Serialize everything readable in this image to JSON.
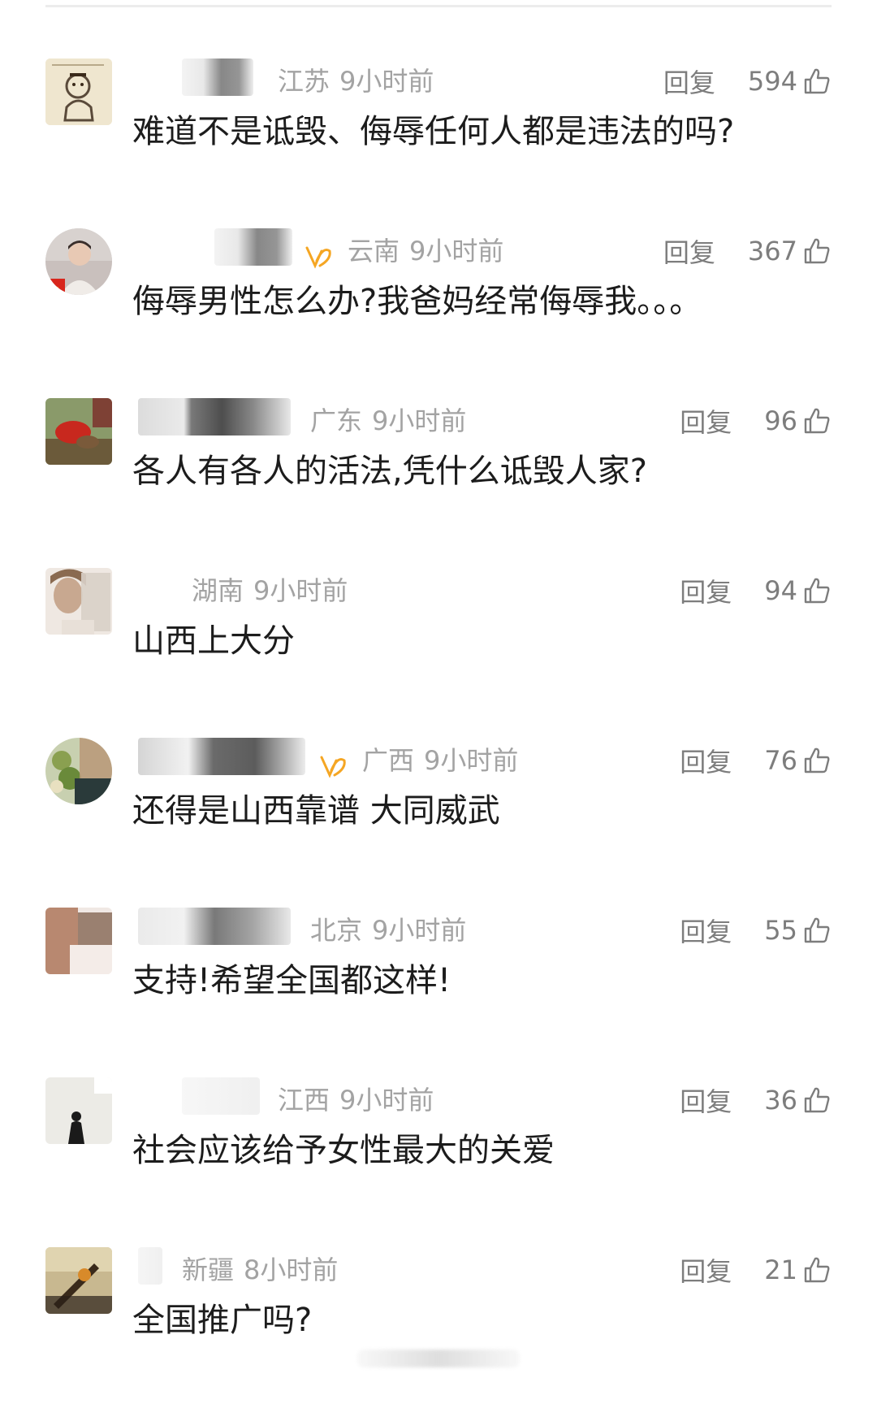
{
  "comments": [
    {
      "region": "江苏",
      "time": "9小时前",
      "reply_label": "回复",
      "likes": "594",
      "text": "难道不是诋毁、侮辱任何人都是违法的吗?",
      "vip": false,
      "avatar_icon": "sketch-avatar"
    },
    {
      "region": "云南",
      "time": "9小时前",
      "reply_label": "回复",
      "likes": "367",
      "text": "侮辱男性怎么办?我爸妈经常侮辱我。。。",
      "vip": true,
      "avatar_icon": "person-photo-avatar"
    },
    {
      "region": "广东",
      "time": "9小时前",
      "reply_label": "回复",
      "likes": "96",
      "text": "各人有各人的活法,凭什么诋毁人家?",
      "vip": false,
      "avatar_icon": "animal-photo-avatar"
    },
    {
      "region": "湖南",
      "time": "9小时前",
      "reply_label": "回复",
      "likes": "94",
      "text": "山西上大分",
      "vip": false,
      "avatar_icon": "blurred-face-avatar"
    },
    {
      "region": "广西",
      "time": "9小时前",
      "reply_label": "回复",
      "likes": "76",
      "text": "还得是山西靠谱 大同威武",
      "vip": true,
      "avatar_icon": "plant-photo-avatar"
    },
    {
      "region": "北京",
      "time": "9小时前",
      "reply_label": "回复",
      "likes": "55",
      "text": "支持!希望全国都这样!",
      "vip": false,
      "avatar_icon": "blurred-avatar"
    },
    {
      "region": "江西",
      "time": "9小时前",
      "reply_label": "回复",
      "likes": "36",
      "text": "社会应该给予女性最大的关爱",
      "vip": false,
      "avatar_icon": "silhouette-avatar"
    },
    {
      "region": "新疆",
      "time": "8小时前",
      "reply_label": "回复",
      "likes": "21",
      "text": "全国推广吗?",
      "vip": false,
      "avatar_icon": "object-photo-avatar"
    }
  ],
  "colors": {
    "meta_text": "#a3a3a3",
    "action_text": "#7d7d7d",
    "comment_text": "#1c1c1c",
    "vip_badge": "#f5a623"
  }
}
